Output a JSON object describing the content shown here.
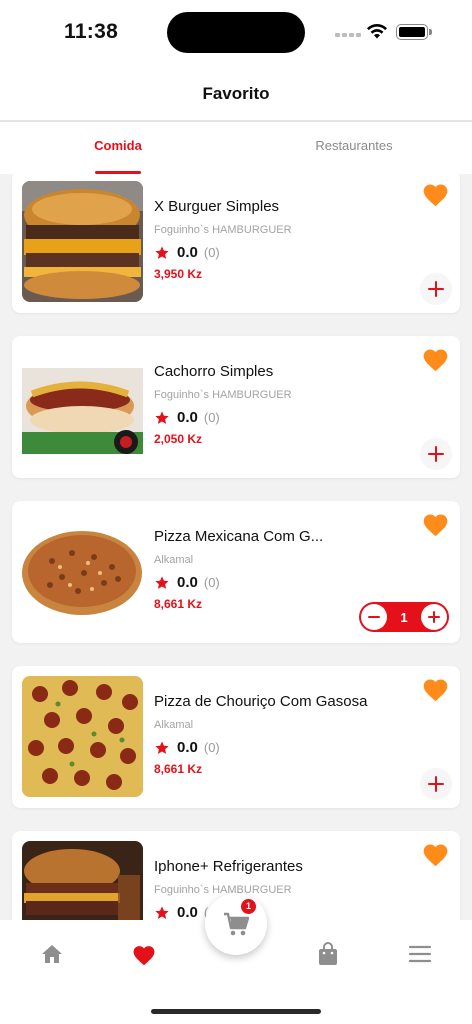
{
  "status_bar": {
    "time": "11:38"
  },
  "header": {
    "title": "Favorito"
  },
  "tabs": [
    {
      "label": "Comida",
      "active": true
    },
    {
      "label": "Restaurantes",
      "active": false
    }
  ],
  "items": [
    {
      "name": "X Burguer Simples",
      "shop": "Foguinho`s HAMBURGUER",
      "rating": "0.0",
      "rating_count": "(0)",
      "price": "3,950 Kz",
      "favorite": true,
      "action": "add",
      "image": "burger"
    },
    {
      "name": "Cachorro Simples",
      "shop": "Foguinho`s HAMBURGUER",
      "rating": "0.0",
      "rating_count": "(0)",
      "price": "2,050 Kz",
      "favorite": true,
      "action": "add",
      "image": "hotdog"
    },
    {
      "name": "Pizza Mexicana Com G...",
      "shop": "Alkamal",
      "rating": "0.0",
      "rating_count": "(0)",
      "price": "8,661 Kz",
      "favorite": true,
      "action": "stepper",
      "quantity": "1",
      "image": "pizza-mexicana"
    },
    {
      "name": "Pizza de Chouriço Com Gasosa",
      "shop": "Alkamal",
      "rating": "0.0",
      "rating_count": "(0)",
      "price": "8,661 Kz",
      "favorite": true,
      "action": "add",
      "image": "pizza-chourico"
    },
    {
      "name": "Iphone+ Refrigerantes",
      "shop": "Foguinho`s HAMBURGUER",
      "rating": "0.0",
      "rating_count": "(0)",
      "price": "",
      "favorite": true,
      "action": "none",
      "image": "burger-combo"
    }
  ],
  "bottom_nav": {
    "items": [
      {
        "icon": "home-icon",
        "active": false
      },
      {
        "icon": "heart-icon",
        "active": true
      },
      {
        "icon": "shopping-bag-icon",
        "active": false
      },
      {
        "icon": "menu-icon",
        "active": false
      }
    ],
    "cart_badge": "1"
  },
  "colors": {
    "accent": "#e4111b",
    "favorite": "#ff8c1a",
    "inactive_icon": "#8e8e8e"
  }
}
